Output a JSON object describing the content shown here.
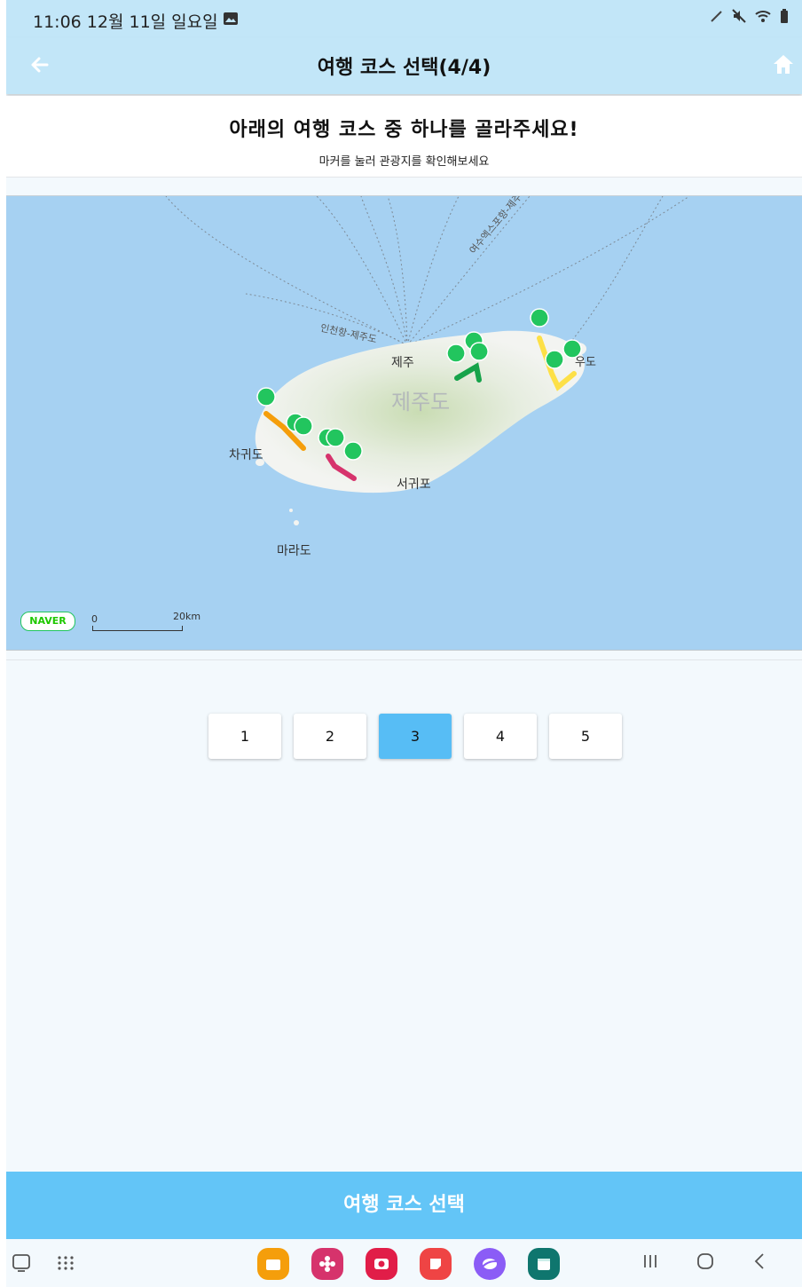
{
  "status_bar": {
    "time_date": "11:06  12월 11일 일요일"
  },
  "app_bar": {
    "title": "여행 코스 선택(4/4)"
  },
  "header": {
    "title": "아래의 여행 코스 중 하나를 골라주세요!",
    "subtitle": "마커를 눌러 관광지를 확인해보세요"
  },
  "map": {
    "labels": {
      "jeju_city": "제주",
      "jeju_island": "제주도",
      "chagwido": "차귀도",
      "seogwipo": "서귀포",
      "marado": "마라도",
      "udo": "우도",
      "incheon_route": "인천항-제주도",
      "yeosu_route": "여수엑스포항-제주"
    },
    "provider_logo": "NAVER",
    "scale": {
      "zero": "0",
      "max": "20km"
    },
    "route_colors": {
      "orange": "#f59e0b",
      "magenta": "#d6336c",
      "green": "#16a34a",
      "yellow": "#fde047",
      "marker": "#22c55e"
    }
  },
  "pager": {
    "pages": [
      "1",
      "2",
      "3",
      "4",
      "5"
    ],
    "selected": "3"
  },
  "select_button": {
    "label": "여행 코스 선택"
  }
}
